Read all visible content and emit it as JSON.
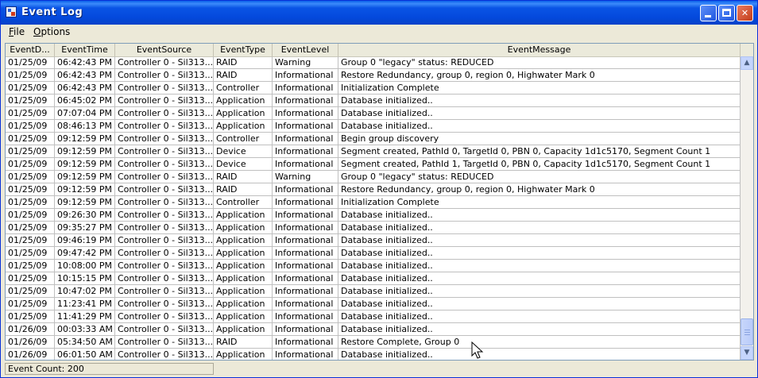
{
  "window": {
    "title": "Event Log"
  },
  "menu": [
    {
      "label": "File",
      "accel": "F"
    },
    {
      "label": "Options",
      "accel": "O"
    }
  ],
  "columns": [
    "EventD...",
    "EventTime",
    "EventSource",
    "EventType",
    "EventLevel",
    "EventMessage"
  ],
  "rows": [
    [
      "01/25/09",
      "06:42:43 PM",
      "Controller 0 - Sil313...",
      "RAID",
      "Warning",
      "Group 0 \"legacy\" status: REDUCED"
    ],
    [
      "01/25/09",
      "06:42:43 PM",
      "Controller 0 - Sil313...",
      "RAID",
      "Informational",
      "Restore Redundancy, group 0, region 0, Highwater Mark 0"
    ],
    [
      "01/25/09",
      "06:42:43 PM",
      "Controller 0 - Sil313...",
      "Controller",
      "Informational",
      "Initialization Complete"
    ],
    [
      "01/25/09",
      "06:45:02 PM",
      "Controller 0 - Sil313...",
      "Application",
      "Informational",
      "Database initialized.."
    ],
    [
      "01/25/09",
      "07:07:04 PM",
      "Controller 0 - Sil313...",
      "Application",
      "Informational",
      "Database initialized.."
    ],
    [
      "01/25/09",
      "08:46:13 PM",
      "Controller 0 - Sil313...",
      "Application",
      "Informational",
      "Database initialized.."
    ],
    [
      "01/25/09",
      "09:12:59 PM",
      "Controller 0 - Sil313...",
      "Controller",
      "Informational",
      "Begin group discovery"
    ],
    [
      "01/25/09",
      "09:12:59 PM",
      "Controller 0 - Sil313...",
      "Device",
      "Informational",
      "Segment created, PathId 0, TargetId 0, PBN 0, Capacity 1d1c5170, Segment Count 1"
    ],
    [
      "01/25/09",
      "09:12:59 PM",
      "Controller 0 - Sil313...",
      "Device",
      "Informational",
      "Segment created, PathId 1, TargetId 0, PBN 0, Capacity 1d1c5170, Segment Count 1"
    ],
    [
      "01/25/09",
      "09:12:59 PM",
      "Controller 0 - Sil313...",
      "RAID",
      "Warning",
      "Group 0 \"legacy\" status: REDUCED"
    ],
    [
      "01/25/09",
      "09:12:59 PM",
      "Controller 0 - Sil313...",
      "RAID",
      "Informational",
      "Restore Redundancy, group 0, region 0, Highwater Mark 0"
    ],
    [
      "01/25/09",
      "09:12:59 PM",
      "Controller 0 - Sil313...",
      "Controller",
      "Informational",
      "Initialization Complete"
    ],
    [
      "01/25/09",
      "09:26:30 PM",
      "Controller 0 - Sil313...",
      "Application",
      "Informational",
      "Database initialized.."
    ],
    [
      "01/25/09",
      "09:35:27 PM",
      "Controller 0 - Sil313...",
      "Application",
      "Informational",
      "Database initialized.."
    ],
    [
      "01/25/09",
      "09:46:19 PM",
      "Controller 0 - Sil313...",
      "Application",
      "Informational",
      "Database initialized.."
    ],
    [
      "01/25/09",
      "09:47:42 PM",
      "Controller 0 - Sil313...",
      "Application",
      "Informational",
      "Database initialized.."
    ],
    [
      "01/25/09",
      "10:08:00 PM",
      "Controller 0 - Sil313...",
      "Application",
      "Informational",
      "Database initialized.."
    ],
    [
      "01/25/09",
      "10:15:15 PM",
      "Controller 0 - Sil313...",
      "Application",
      "Informational",
      "Database initialized.."
    ],
    [
      "01/25/09",
      "10:47:02 PM",
      "Controller 0 - Sil313...",
      "Application",
      "Informational",
      "Database initialized.."
    ],
    [
      "01/25/09",
      "11:23:41 PM",
      "Controller 0 - Sil313...",
      "Application",
      "Informational",
      "Database initialized.."
    ],
    [
      "01/25/09",
      "11:41:29 PM",
      "Controller 0 - Sil313...",
      "Application",
      "Informational",
      "Database initialized.."
    ],
    [
      "01/26/09",
      "00:03:33 AM",
      "Controller 0 - Sil313...",
      "Application",
      "Informational",
      "Database initialized.."
    ],
    [
      "01/26/09",
      "05:34:50 AM",
      "Controller 0 - Sil313...",
      "RAID",
      "Informational",
      "Restore Complete, Group 0"
    ],
    [
      "01/26/09",
      "06:01:50 AM",
      "Controller 0 - Sil313...",
      "Application",
      "Informational",
      "Database initialized.."
    ]
  ],
  "status": {
    "text": "Event Count: 200"
  },
  "icons": {
    "scroll_up": "chevron-up-icon",
    "scroll_down": "chevron-down-icon",
    "minimize": "minimize-icon",
    "maximize": "maximize-icon",
    "close": "close-icon"
  }
}
